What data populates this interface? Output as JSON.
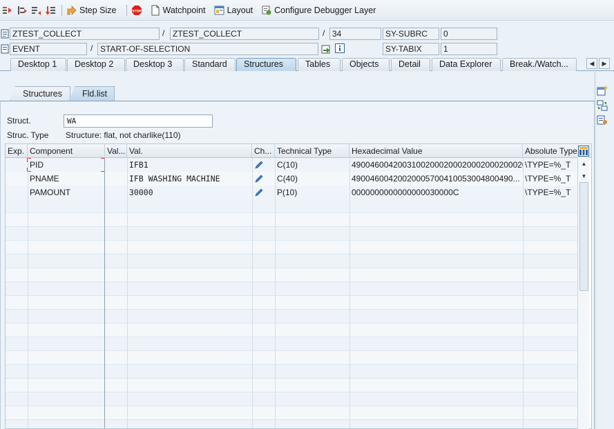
{
  "toolbar": {
    "step_size": "Step Size",
    "watchpoint": "Watchpoint",
    "layout": "Layout",
    "configure": "Configure Debugger Layer"
  },
  "header": {
    "program": "ZTEST_COLLECT",
    "include": "ZTEST_COLLECT",
    "line": "34",
    "event_type": "EVENT",
    "event_name": "START-OF-SELECTION",
    "sysvar1_name": "SY-SUBRC",
    "sysvar1_value": "0",
    "sysvar2_name": "SY-TABIX",
    "sysvar2_value": "1",
    "sep1": "/",
    "sep2": "/",
    "sep3": "/"
  },
  "tabs": [
    {
      "label": "Desktop 1"
    },
    {
      "label": "Desktop 2"
    },
    {
      "label": "Desktop 3"
    },
    {
      "label": "Standard"
    },
    {
      "label": "Structures"
    },
    {
      "label": "Tables"
    },
    {
      "label": "Objects"
    },
    {
      "label": "Detail"
    },
    {
      "label": "Data Explorer"
    },
    {
      "label": "Break./Watch..."
    }
  ],
  "subtabs": [
    {
      "label": "Structures"
    },
    {
      "label": "Fld.list"
    }
  ],
  "struct": {
    "label": "Struct.",
    "value": "WA",
    "type_label": "Struc. Type",
    "type_value": "Structure: flat, not charlike(110)"
  },
  "grid": {
    "columns": [
      "Exp.",
      "Component",
      "Val...",
      "Val.",
      "Ch...",
      "Technical Type",
      "Hexadecimal Value",
      "Absolute Type"
    ],
    "rows": [
      {
        "component": "PID",
        "value": "IFB1",
        "tech": "C(10)",
        "hex": "49004600420031002000200020002000200020...",
        "abs": "\\TYPE=%_T"
      },
      {
        "component": "PNAME",
        "value": "IFB WASHING MACHINE",
        "tech": "C(40)",
        "hex": "49004600420020005700410053004800490...",
        "abs": "\\TYPE=%_T"
      },
      {
        "component": "PAMOUNT",
        "value": "30000",
        "tech": "P(10)",
        "hex": "0000000000000000030000C",
        "abs": "\\TYPE=%_T"
      }
    ]
  }
}
